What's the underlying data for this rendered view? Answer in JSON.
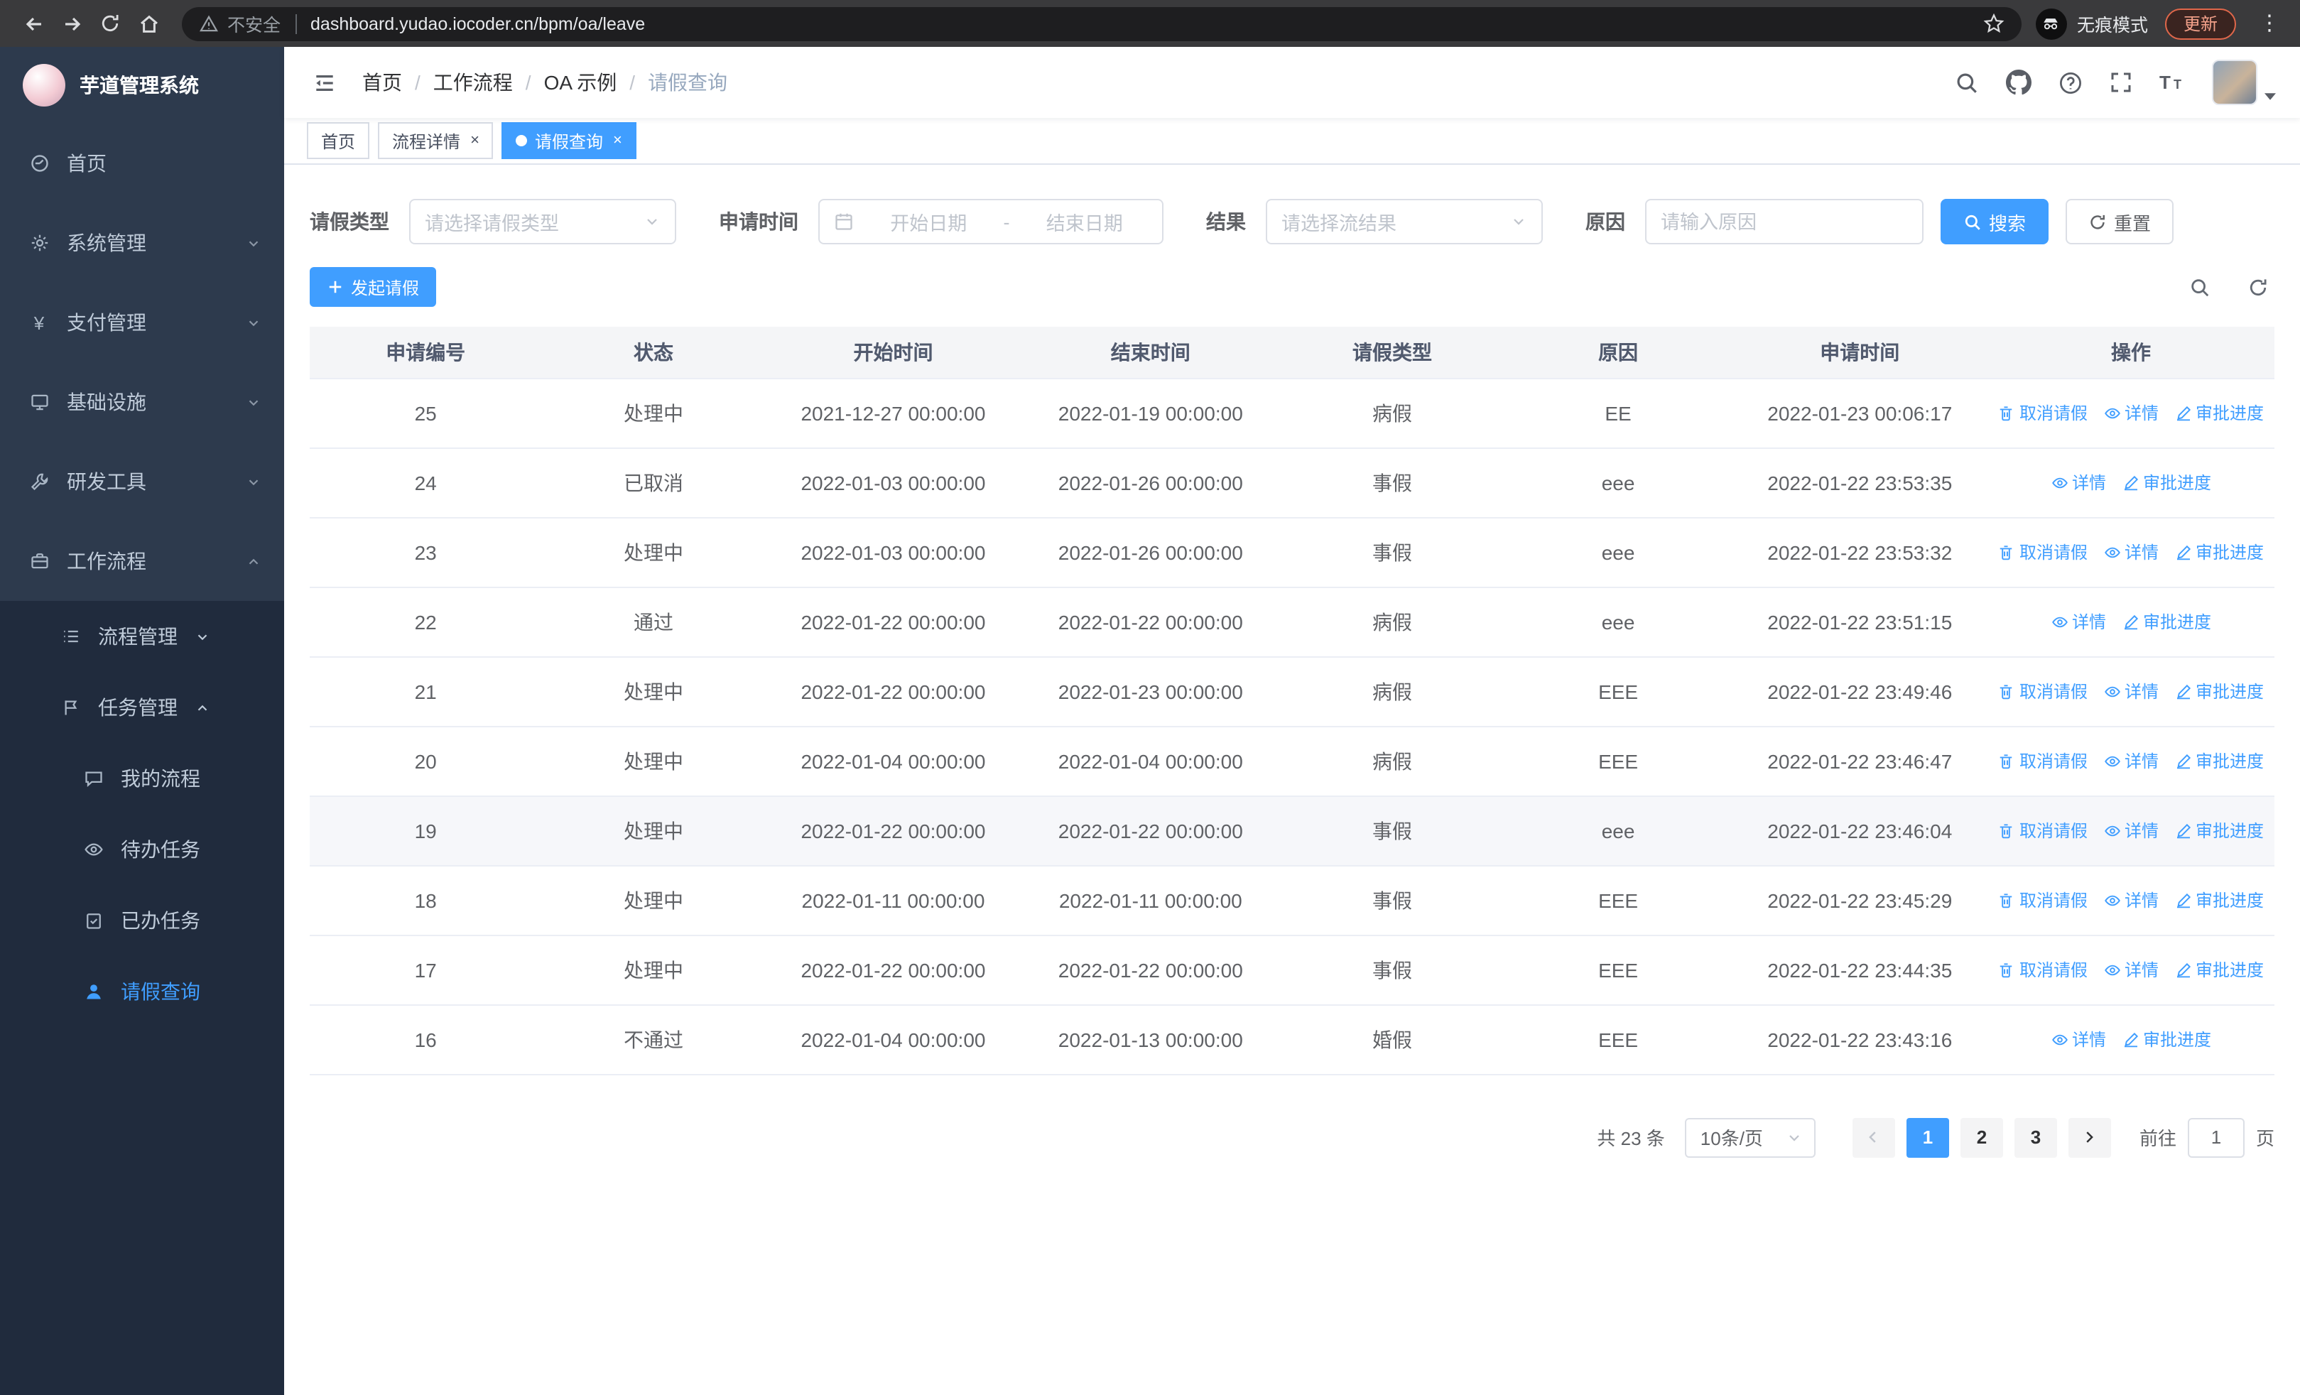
{
  "browser": {
    "security_label": "不安全",
    "url": "dashboard.yudao.iocoder.cn/bpm/oa/leave",
    "incognito_label": "无痕模式",
    "update_label": "更新",
    "menu_glyph": "⋮"
  },
  "sidebar": {
    "logo_title": "芋道管理系统",
    "items": [
      {
        "label": "首页",
        "icon": "dashboard-icon"
      },
      {
        "label": "系统管理",
        "icon": "gear-icon"
      },
      {
        "label": "支付管理",
        "icon": "yen-icon"
      },
      {
        "label": "基础设施",
        "icon": "infrastructure-icon"
      },
      {
        "label": "研发工具",
        "icon": "tools-icon"
      },
      {
        "label": "工作流程",
        "icon": "workflow-icon"
      }
    ],
    "submenu": [
      {
        "label": "流程管理",
        "icon": "process-list-icon"
      },
      {
        "label": "任务管理",
        "icon": "task-flag-icon"
      }
    ],
    "task_children": [
      {
        "label": "我的流程",
        "icon": "my-process-icon"
      },
      {
        "label": "待办任务",
        "icon": "todo-eye-icon"
      },
      {
        "label": "已办任务",
        "icon": "done-task-icon"
      },
      {
        "label": "请假查询",
        "icon": "leave-user-icon",
        "active": true
      }
    ]
  },
  "header": {
    "breadcrumb": [
      "首页",
      "工作流程",
      "OA 示例",
      "请假查询"
    ]
  },
  "tabs": [
    {
      "label": "首页"
    },
    {
      "label": "流程详情",
      "closable": true
    },
    {
      "label": "请假查询",
      "closable": true,
      "active": true
    }
  ],
  "filters": {
    "leave_type_label": "请假类型",
    "leave_type_placeholder": "请选择请假类型",
    "apply_time_label": "申请时间",
    "start_date_placeholder": "开始日期",
    "date_separator": "-",
    "end_date_placeholder": "结束日期",
    "result_label": "结果",
    "result_placeholder": "请选择流结果",
    "reason_label": "原因",
    "reason_placeholder": "请输入原因",
    "search_label": "搜索",
    "reset_label": "重置"
  },
  "toolbar": {
    "create_label": "发起请假"
  },
  "table": {
    "columns": [
      "申请编号",
      "状态",
      "开始时间",
      "结束时间",
      "请假类型",
      "原因",
      "申请时间",
      "操作"
    ],
    "action_labels": {
      "cancel": "取消请假",
      "detail": "详情",
      "progress": "审批进度"
    },
    "rows": [
      {
        "id": "25",
        "status": "处理中",
        "start": "2021-12-27 00:00:00",
        "end": "2022-01-19 00:00:00",
        "type": "病假",
        "reason": "EE",
        "apply_time": "2022-01-23 00:06:17",
        "cancellable": true,
        "highlighted": false
      },
      {
        "id": "24",
        "status": "已取消",
        "start": "2022-01-03 00:00:00",
        "end": "2022-01-26 00:00:00",
        "type": "事假",
        "reason": "eee",
        "apply_time": "2022-01-22 23:53:35",
        "cancellable": false,
        "highlighted": false
      },
      {
        "id": "23",
        "status": "处理中",
        "start": "2022-01-03 00:00:00",
        "end": "2022-01-26 00:00:00",
        "type": "事假",
        "reason": "eee",
        "apply_time": "2022-01-22 23:53:32",
        "cancellable": true,
        "highlighted": false
      },
      {
        "id": "22",
        "status": "通过",
        "start": "2022-01-22 00:00:00",
        "end": "2022-01-22 00:00:00",
        "type": "病假",
        "reason": "eee",
        "apply_time": "2022-01-22 23:51:15",
        "cancellable": false,
        "highlighted": false
      },
      {
        "id": "21",
        "status": "处理中",
        "start": "2022-01-22 00:00:00",
        "end": "2022-01-23 00:00:00",
        "type": "病假",
        "reason": "EEE",
        "apply_time": "2022-01-22 23:49:46",
        "cancellable": true,
        "highlighted": false
      },
      {
        "id": "20",
        "status": "处理中",
        "start": "2022-01-04 00:00:00",
        "end": "2022-01-04 00:00:00",
        "type": "病假",
        "reason": "EEE",
        "apply_time": "2022-01-22 23:46:47",
        "cancellable": true,
        "highlighted": false
      },
      {
        "id": "19",
        "status": "处理中",
        "start": "2022-01-22 00:00:00",
        "end": "2022-01-22 00:00:00",
        "type": "事假",
        "reason": "eee",
        "apply_time": "2022-01-22 23:46:04",
        "cancellable": true,
        "highlighted": true
      },
      {
        "id": "18",
        "status": "处理中",
        "start": "2022-01-11 00:00:00",
        "end": "2022-01-11 00:00:00",
        "type": "事假",
        "reason": "EEE",
        "apply_time": "2022-01-22 23:45:29",
        "cancellable": true,
        "highlighted": false
      },
      {
        "id": "17",
        "status": "处理中",
        "start": "2022-01-22 00:00:00",
        "end": "2022-01-22 00:00:00",
        "type": "事假",
        "reason": "EEE",
        "apply_time": "2022-01-22 23:44:35",
        "cancellable": true,
        "highlighted": false
      },
      {
        "id": "16",
        "status": "不通过",
        "start": "2022-01-04 00:00:00",
        "end": "2022-01-13 00:00:00",
        "type": "婚假",
        "reason": "EEE",
        "apply_time": "2022-01-22 23:43:16",
        "cancellable": false,
        "highlighted": false
      }
    ]
  },
  "pagination": {
    "total_label": "共 23 条",
    "page_size_label": "10条/页",
    "pages": [
      "1",
      "2",
      "3"
    ],
    "active_page": "1",
    "goto_label": "前往",
    "goto_value": "1",
    "page_suffix": "页"
  },
  "colors": {
    "accent": "#409eff",
    "sidebar_bg": "#2d3a4d",
    "sidebar_submenu_bg": "#202b3d",
    "table_header_bg": "#f4f5f7"
  }
}
